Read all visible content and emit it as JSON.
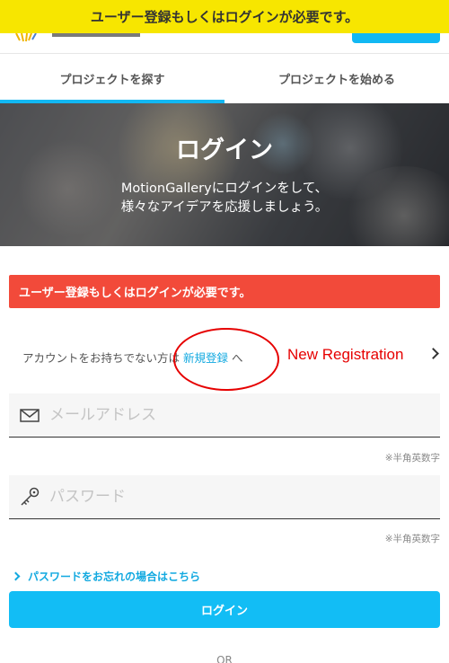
{
  "banner": {
    "text": "ユーザー登録もしくはログインが必要です。"
  },
  "tabs": [
    {
      "label": "プロジェクトを探す"
    },
    {
      "label": "プロジェクトを始める"
    }
  ],
  "hero": {
    "title": "ログイン",
    "line1": "MotionGalleryにログインをして、",
    "line2": "様々なアイデアを応援しましょう。"
  },
  "alert": {
    "text": "ユーザー登録もしくはログインが必要です。"
  },
  "signup": {
    "prefix": "アカウントをお持ちでない方は ",
    "link": "新規登録",
    "suffix": " へ",
    "annotation": "New Registration"
  },
  "email": {
    "placeholder": "メールアドレス",
    "value": "",
    "hint": "※半角英数字"
  },
  "password": {
    "placeholder": "パスワード",
    "value": "",
    "hint": "※半角英数字"
  },
  "forgot_label": "パスワードをお忘れの場合はこちら",
  "login_button": "ログイン",
  "or_text": "OR",
  "colors": {
    "accent": "#12bdf5",
    "alert": "#f24a3a",
    "banner": "#f7e600",
    "annotation": "#e60000"
  },
  "icons": [
    "envelope-icon",
    "key-icon",
    "chevron-right-icon"
  ]
}
